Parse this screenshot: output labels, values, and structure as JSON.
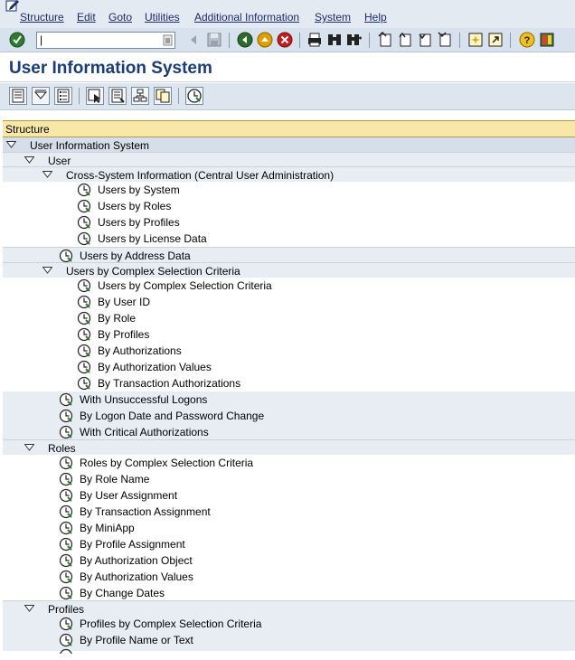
{
  "menubar": {
    "items": [
      {
        "label": "Structure"
      },
      {
        "label": "Edit"
      },
      {
        "label": "Goto"
      },
      {
        "label": "Utilities"
      },
      {
        "label": "Additional Information"
      },
      {
        "label": "System"
      },
      {
        "label": "Help"
      }
    ]
  },
  "toolbar": {
    "command_field_value": "|"
  },
  "title": "User Information System",
  "tree": {
    "header": "Structure",
    "rows": [
      {
        "label": "User Information System"
      },
      {
        "label": "User"
      },
      {
        "label": "Cross-System Information (Central User Administration)"
      },
      {
        "label": "Users by System"
      },
      {
        "label": "Users by Roles"
      },
      {
        "label": "Users by Profiles"
      },
      {
        "label": "Users by License Data"
      },
      {
        "label": "Users by Address Data"
      },
      {
        "label": "Users by Complex Selection Criteria"
      },
      {
        "label": "Users by Complex Selection Criteria"
      },
      {
        "label": "By User ID"
      },
      {
        "label": "By Role"
      },
      {
        "label": "By Profiles"
      },
      {
        "label": "By Authorizations"
      },
      {
        "label": "By Authorization Values"
      },
      {
        "label": "By Transaction Authorizations"
      },
      {
        "label": "With Unsuccessful Logons"
      },
      {
        "label": "By Logon Date and Password Change"
      },
      {
        "label": "With Critical Authorizations"
      },
      {
        "label": "Roles"
      },
      {
        "label": "Roles by Complex Selection Criteria"
      },
      {
        "label": "By Role Name"
      },
      {
        "label": "By User Assignment"
      },
      {
        "label": "By Transaction Assignment"
      },
      {
        "label": "By MiniApp"
      },
      {
        "label": "By Profile Assignment"
      },
      {
        "label": "By Authorization Object"
      },
      {
        "label": "By Authorization Values"
      },
      {
        "label": "By Change Dates"
      },
      {
        "label": "Profiles"
      },
      {
        "label": "Profiles by Complex Selection Criteria"
      },
      {
        "label": "By Profile Name or Text"
      }
    ]
  }
}
